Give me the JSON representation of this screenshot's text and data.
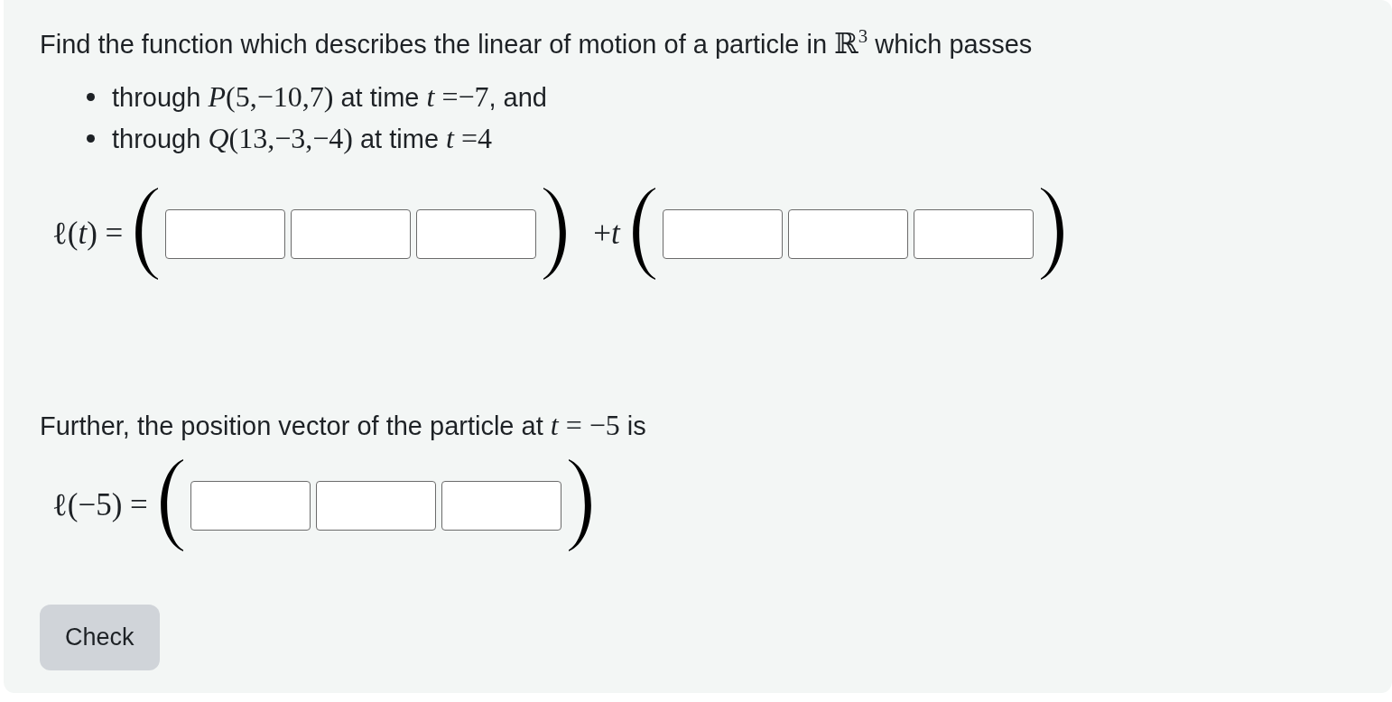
{
  "question": {
    "intro": [
      {
        "kind": "text",
        "text": "Find the function which describes the linear of motion of a particle in "
      },
      {
        "kind": "math",
        "text": "ℝ$^{3}$"
      },
      {
        "kind": "text",
        "text": " which passes"
      }
    ],
    "conditions": [
      {
        "parts": [
          {
            "kind": "text",
            "text": "through "
          },
          {
            "kind": "math",
            "text": "*P*(5,−10,7)"
          },
          {
            "kind": "text",
            "text": " at time "
          },
          {
            "kind": "math",
            "text": "*t* =−7"
          },
          {
            "kind": "text",
            "text": ", and"
          }
        ]
      },
      {
        "parts": [
          {
            "kind": "text",
            "text": "through "
          },
          {
            "kind": "math",
            "text": "*Q*(13,−3,−4)"
          },
          {
            "kind": "text",
            "text": " at time "
          },
          {
            "kind": "math",
            "text": "*t* =4"
          }
        ]
      }
    ]
  },
  "line_equation": {
    "terms": [
      {
        "kind": "lhs",
        "text": "ℓ(*t*) ="
      },
      {
        "kind": "vector",
        "fields": [
          {
            "kind": "blank"
          },
          {
            "kind": "blank"
          },
          {
            "kind": "blank"
          }
        ]
      },
      {
        "kind": "operator",
        "text": "+*t*"
      },
      {
        "kind": "vector",
        "fields": [
          {
            "kind": "blank"
          },
          {
            "kind": "blank"
          },
          {
            "kind": "blank"
          }
        ]
      }
    ]
  },
  "followup": {
    "parts": [
      {
        "kind": "text",
        "text": "Further, the position vector of the particle at "
      },
      {
        "kind": "math",
        "text": "*t* = −5"
      },
      {
        "kind": "text",
        "text": " is"
      }
    ]
  },
  "position_equation": {
    "terms": [
      {
        "kind": "lhs",
        "text": "ℓ(−5) ="
      },
      {
        "kind": "vector",
        "fields": [
          {
            "kind": "blank"
          },
          {
            "kind": "blank"
          },
          {
            "kind": "blank"
          }
        ]
      }
    ]
  },
  "check_button": {
    "label": "Check"
  }
}
